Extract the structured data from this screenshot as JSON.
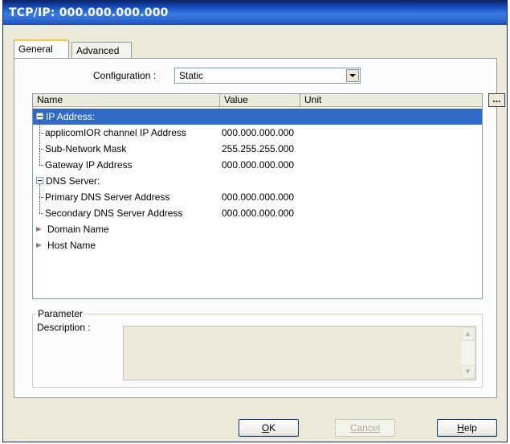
{
  "window": {
    "title": "TCP/IP: 000.000.000.000"
  },
  "tabs": [
    {
      "label": "General",
      "active": true
    },
    {
      "label": "Advanced",
      "active": false
    }
  ],
  "configuration": {
    "label": "Configuration :",
    "value": "Static"
  },
  "grid": {
    "columns": [
      "Name",
      "Value",
      "Unit"
    ],
    "ellipsis_label": "...",
    "rows": [
      {
        "name": "IP Address:",
        "value": "",
        "type": "group",
        "selected": true
      },
      {
        "name": "applicomIOR channel IP Address",
        "value": "000.000.000.000",
        "type": "child"
      },
      {
        "name": "Sub-Network Mask",
        "value": "255.255.255.000",
        "type": "child"
      },
      {
        "name": "Gateway IP Address",
        "value": "000.000.000.000",
        "type": "child-last"
      },
      {
        "name": "DNS Server:",
        "value": "",
        "type": "group"
      },
      {
        "name": "Primary DNS Server Address",
        "value": "000.000.000.000",
        "type": "child"
      },
      {
        "name": "Secondary DNS Server Address",
        "value": "000.000.000.000",
        "type": "child-last"
      },
      {
        "name": "Domain Name",
        "value": "",
        "type": "arrow"
      },
      {
        "name": "Host Name",
        "value": "",
        "type": "arrow"
      }
    ]
  },
  "parameter": {
    "legend": "Parameter",
    "description_label": "Description :",
    "description_value": ""
  },
  "buttons": {
    "ok": {
      "underlined": "O",
      "rest": "K"
    },
    "cancel": {
      "label": "Cancel"
    },
    "help": {
      "underlined": "H",
      "rest": "elp"
    }
  },
  "colors": {
    "selection": "#316ac5",
    "titlebar": "#1a54c8",
    "face": "#ece9d8"
  }
}
